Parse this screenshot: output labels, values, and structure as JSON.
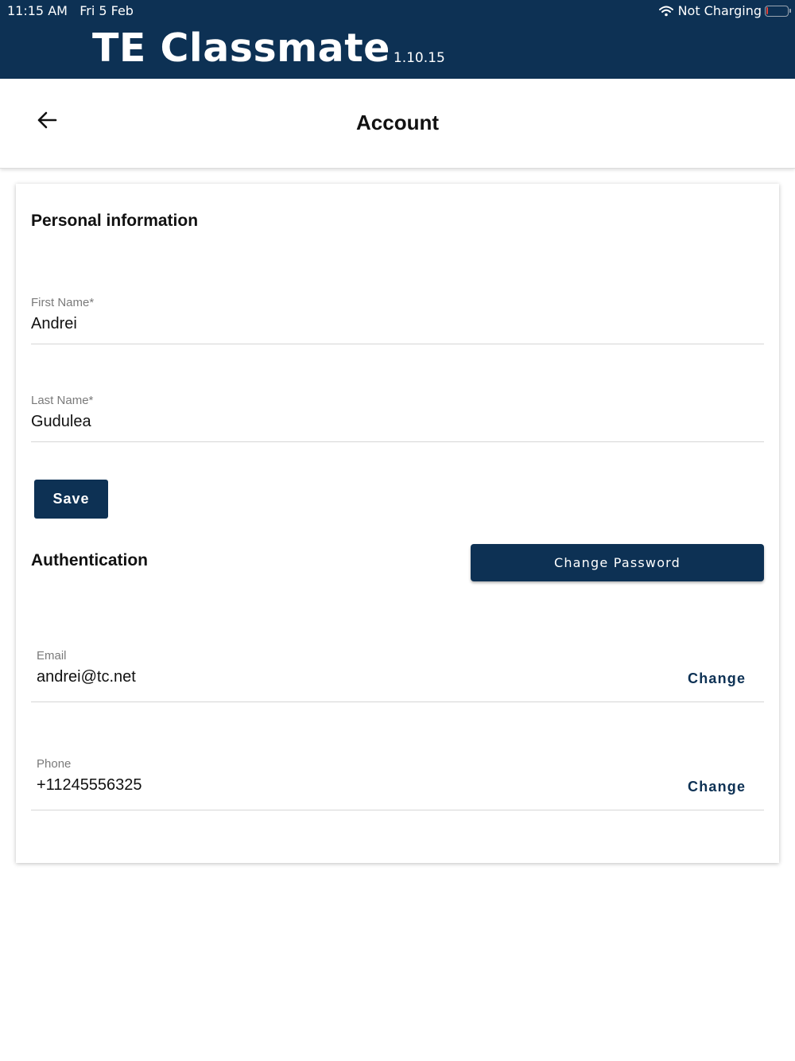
{
  "status_bar": {
    "time": "11:15 AM",
    "date": "Fri 5 Feb",
    "charging_status": "Not Charging",
    "battery_color": "#e0443a"
  },
  "app": {
    "name": "TE Classmate",
    "version": "1.10.15",
    "brand_color": "#0d3154"
  },
  "header": {
    "title": "Account",
    "back_icon": "arrow-left-icon"
  },
  "personal": {
    "title": "Personal information",
    "first_name": {
      "label": "First Name*",
      "value": "Andrei"
    },
    "last_name": {
      "label": "Last Name*",
      "value": "Gudulea"
    },
    "save_label": "Save"
  },
  "auth": {
    "title": "Authentication",
    "change_password_label": "Change Password",
    "email": {
      "label": "Email",
      "value": "andrei@tc.net",
      "action": "Change"
    },
    "phone": {
      "label": "Phone",
      "value": "+11245556325",
      "action": "Change"
    }
  }
}
